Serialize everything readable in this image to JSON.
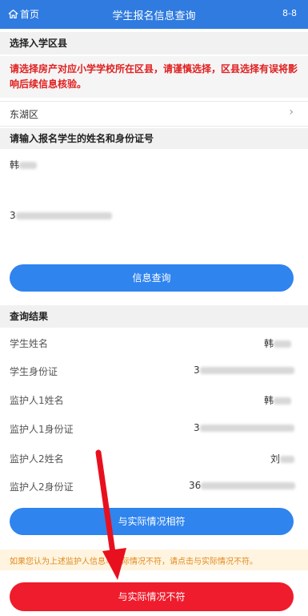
{
  "header": {
    "home_label": "首页",
    "title": "学生报名信息查询",
    "tag": "8-8"
  },
  "select_district": {
    "heading": "选择入学区县",
    "warning": "请选择房产对应小学学校所在区县，请谨慎选择，区县选择有误将影响后续信息核验。",
    "value": "东湖区"
  },
  "student_input": {
    "heading": "请输入报名学生的姓名和身份证号",
    "name_value": "韩",
    "id_value": "3"
  },
  "query_button": "信息查询",
  "results": {
    "heading": "查询结果",
    "rows": [
      {
        "label": "学生姓名",
        "value": "韩"
      },
      {
        "label": "学生身份证",
        "value": "3"
      },
      {
        "label": "监护人1姓名",
        "value": "韩"
      },
      {
        "label": "监护人1身份证",
        "value": "3"
      },
      {
        "label": "监护人2姓名",
        "value": "刘"
      },
      {
        "label": "监护人2身份证",
        "value": "36"
      }
    ]
  },
  "match_button": "与实际情况相符",
  "notice": "如果您认为上述监护人信息与实际情况不符，请点击与实际情况不符。",
  "mismatch_button": "与实际情况不符",
  "colors": {
    "header": "#2f7be0",
    "primary_button": "#2f84ee",
    "danger_button": "#ee1c2c",
    "warning_text": "#e02020",
    "annotation_arrow": "#e8101e"
  }
}
